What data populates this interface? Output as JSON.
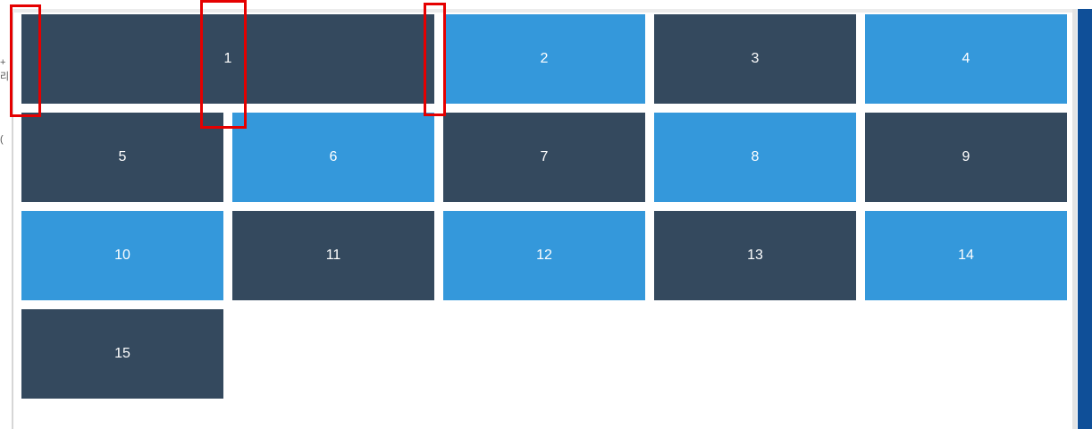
{
  "left_strip": {
    "fragments": [
      "+",
      "리",
      "("
    ]
  },
  "grid": {
    "tiles": [
      {
        "label": "1",
        "color": "#34495e",
        "span": 2
      },
      {
        "label": "2",
        "color": "#3498db"
      },
      {
        "label": "3",
        "color": "#34495e"
      },
      {
        "label": "4",
        "color": "#3498db"
      },
      {
        "label": "5",
        "color": "#34495e"
      },
      {
        "label": "6",
        "color": "#3498db"
      },
      {
        "label": "7",
        "color": "#34495e"
      },
      {
        "label": "8",
        "color": "#3498db"
      },
      {
        "label": "9",
        "color": "#34495e"
      },
      {
        "label": "10",
        "color": "#3498db"
      },
      {
        "label": "11",
        "color": "#34495e"
      },
      {
        "label": "12",
        "color": "#3498db"
      },
      {
        "label": "13",
        "color": "#34495e"
      },
      {
        "label": "14",
        "color": "#3498db"
      },
      {
        "label": "15",
        "color": "#34495e"
      }
    ]
  },
  "colors": {
    "dark": "#34495e",
    "light": "#3498db",
    "scrollbar": "#0f4f98",
    "highlight": "#e50000"
  }
}
